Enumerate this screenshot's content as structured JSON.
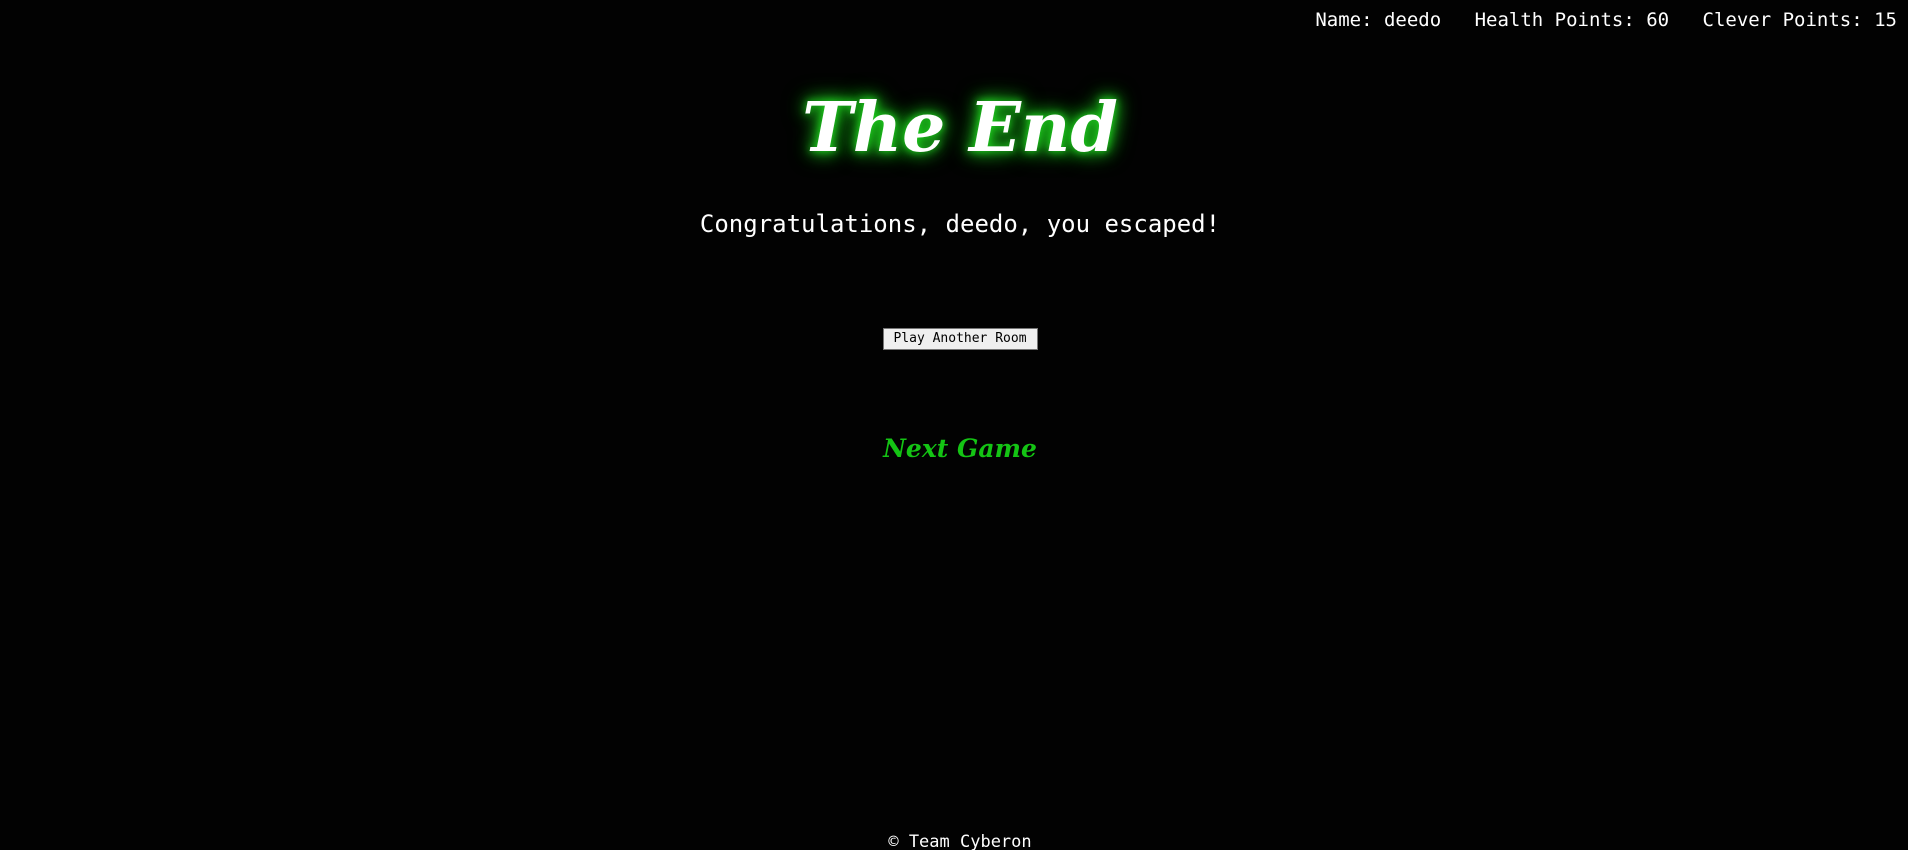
{
  "header": {
    "name": "Name: deedo",
    "health": "Health Points: 60",
    "clever": "Clever Points: 15"
  },
  "main": {
    "title": "The End",
    "message": "Congratulations, deedo, you escaped!",
    "play_button_label": "Play Another Room",
    "next_game_label": "Next Game"
  },
  "footer": {
    "text": "© Team Cyberon"
  },
  "colors": {
    "background": "#020202",
    "accent_green": "#14c414",
    "glow_green": "#1fd11f",
    "text": "#ffffff"
  }
}
